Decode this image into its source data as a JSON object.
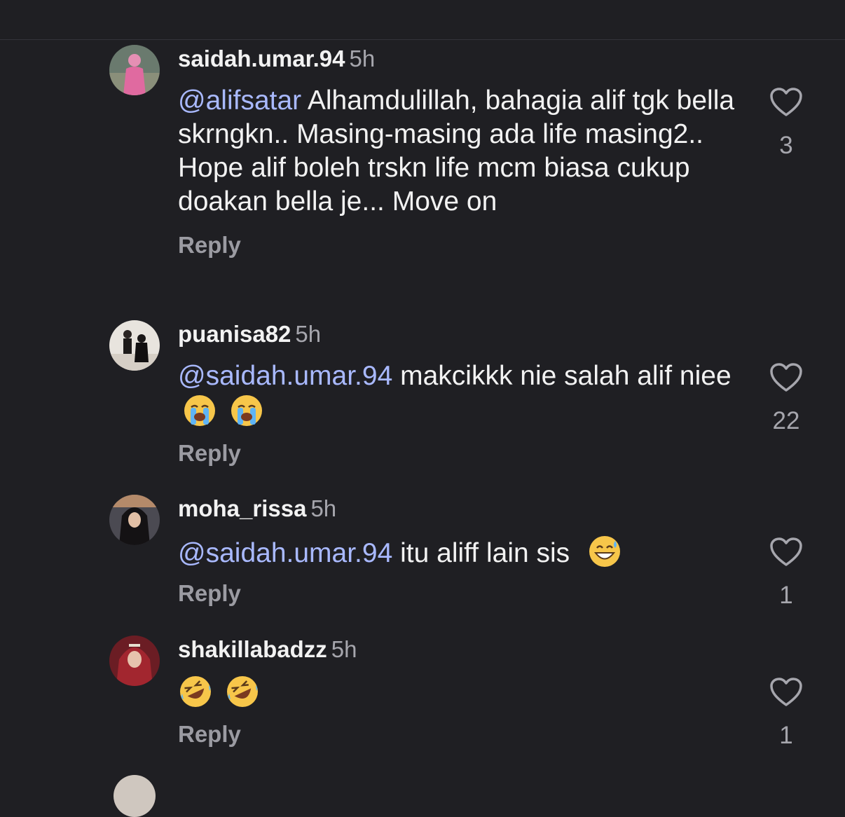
{
  "comments": [
    {
      "username": "saidah.umar.94",
      "time": "5h",
      "mention": "@alifsatar",
      "text": " Alhamdulillah, bahagia alif tgk bella skrngkn.. Masing-masing ada life masing2.. Hope alif boleh trskn life mcm biasa cukup doakan bella je... Move on",
      "reply_label": "Reply",
      "likes": "3"
    },
    {
      "username": "puanisa82",
      "time": "5h",
      "mention": "@saidah.umar.94",
      "text": " makcikkk nie salah alif niee",
      "emojis": [
        "loudly-crying-face",
        "loudly-crying-face"
      ],
      "reply_label": "Reply",
      "likes": "22"
    },
    {
      "username": "moha_rissa",
      "time": "5h",
      "mention": "@saidah.umar.94",
      "text": " itu aliff lain sis",
      "emojis": [
        "grinning-face-with-sweat"
      ],
      "reply_label": "Reply",
      "likes": "1"
    },
    {
      "username": "shakillabadzz",
      "time": "5h",
      "mention": "",
      "text": "",
      "emojis": [
        "rolling-on-floor-laughing",
        "rolling-on-floor-laughing"
      ],
      "reply_label": "Reply",
      "likes": "1"
    }
  ],
  "colors": {
    "background": "#1f1f23",
    "mention": "#a9b9ff",
    "muted": "#a6a6ad"
  }
}
